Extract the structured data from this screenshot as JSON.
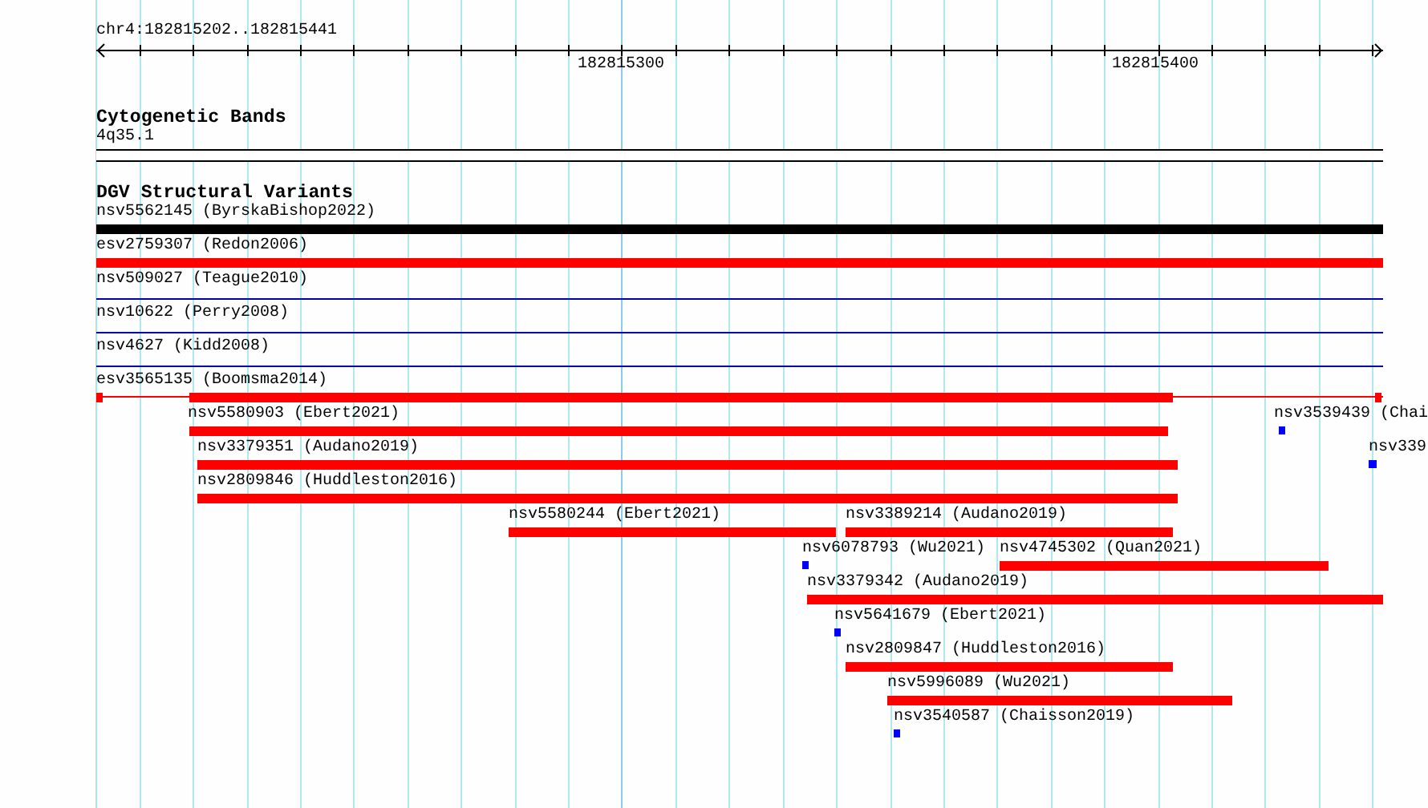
{
  "ruler": {
    "region": "chr4:182815202..182815441",
    "ticks": [
      "182815300",
      "182815400"
    ]
  },
  "tracks": [
    {
      "title": "Cytogenetic Bands",
      "rows": [
        {
          "features": [
            {
              "label": "4q35.1",
              "kind": "band"
            }
          ]
        }
      ]
    },
    {
      "title": "DGV Structural Variants",
      "rows": [
        {
          "features": [
            {
              "label": "nsv5562145 (ByrskaBishop2022)",
              "kind": "bar",
              "color": "#000000"
            }
          ]
        },
        {
          "features": [
            {
              "label": "esv2759307 (Redon2006)",
              "kind": "bar",
              "color": "#ff0000"
            }
          ]
        },
        {
          "features": [
            {
              "label": "nsv509027 (Teague2010)",
              "kind": "line",
              "color": "#0000aa"
            }
          ]
        },
        {
          "features": [
            {
              "label": "nsv10622 (Perry2008)",
              "kind": "line",
              "color": "#0000aa"
            }
          ]
        },
        {
          "features": [
            {
              "label": "nsv4627 (Kidd2008)",
              "kind": "line",
              "color": "#0000aa"
            }
          ]
        },
        {
          "features": [
            {
              "label": "esv3565135 (Boomsma2014)",
              "kind": "split",
              "color": "#ff0000"
            }
          ]
        },
        {
          "features": [
            {
              "label": "nsv5580903 (Ebert2021)",
              "kind": "bar",
              "color": "#ff0000"
            },
            {
              "label": "nsv3539439 (Chai",
              "kind": "point",
              "color": "#0000ff"
            }
          ]
        },
        {
          "features": [
            {
              "label": "nsv3379351 (Audano2019)",
              "kind": "bar",
              "color": "#ff0000"
            },
            {
              "label": "nsv339",
              "kind": "point",
              "color": "#0000ff"
            }
          ]
        },
        {
          "features": [
            {
              "label": "nsv2809846 (Huddleston2016)",
              "kind": "bar",
              "color": "#ff0000"
            }
          ]
        },
        {
          "features": [
            {
              "label": "nsv5580244 (Ebert2021)",
              "kind": "bar",
              "color": "#ff0000"
            },
            {
              "label": "nsv3389214 (Audano2019)",
              "kind": "bar",
              "color": "#ff0000"
            }
          ]
        },
        {
          "features": [
            {
              "label": "nsv6078793 (Wu2021)",
              "kind": "point",
              "color": "#0000ff"
            },
            {
              "label": "nsv4745302 (Quan2021)",
              "kind": "bar",
              "color": "#ff0000"
            }
          ]
        },
        {
          "features": [
            {
              "label": "nsv3379342 (Audano2019)",
              "kind": "bar",
              "color": "#ff0000"
            }
          ]
        },
        {
          "features": [
            {
              "label": "nsv5641679 (Ebert2021)",
              "kind": "point",
              "color": "#0000ff"
            }
          ]
        },
        {
          "features": [
            {
              "label": "nsv2809847 (Huddleston2016)",
              "kind": "bar",
              "color": "#ff0000"
            }
          ]
        },
        {
          "features": [
            {
              "label": "nsv5996089 (Wu2021)",
              "kind": "bar",
              "color": "#ff0000"
            }
          ]
        },
        {
          "features": [
            {
              "label": "nsv3540587 (Chaisson2019)",
              "kind": "point",
              "color": "#0000ff"
            }
          ]
        }
      ]
    }
  ]
}
